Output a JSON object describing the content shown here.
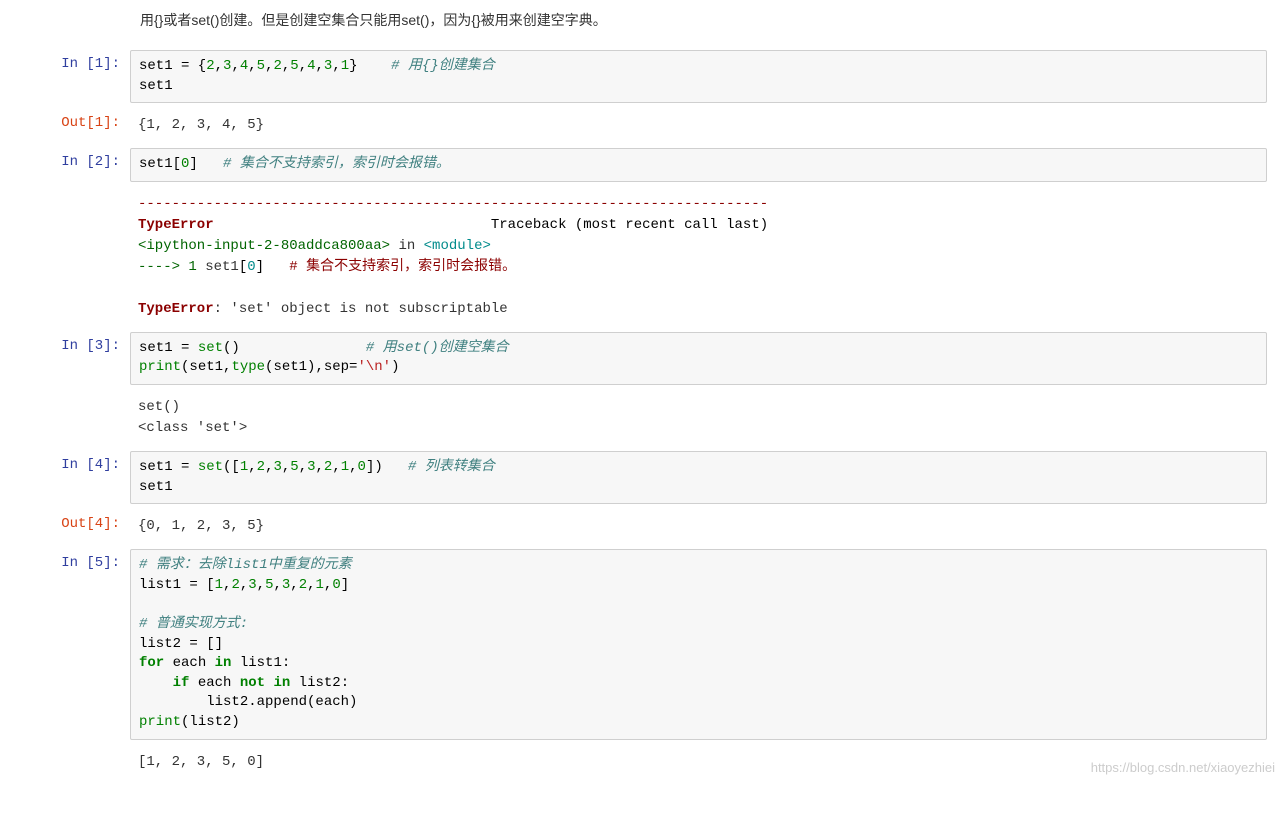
{
  "intro": "用{}或者set()创建。但是创建空集合只能用set()，因为{}被用来创建空字典。",
  "cells": {
    "in1": {
      "prompt": "In  [1]:",
      "line1_a": "set1 = {",
      "line1_b": "2",
      "line1_c": ",",
      "line1_d": "3",
      "line1_e": ",",
      "line1_f": "4",
      "line1_g": ",",
      "line1_h": "5",
      "line1_i": ",",
      "line1_j": "2",
      "line1_k": ",",
      "line1_l": "5",
      "line1_m": ",",
      "line1_n": "4",
      "line1_o": ",",
      "line1_p": "3",
      "line1_q": ",",
      "line1_r": "1",
      "line1_s": "}    ",
      "line1_comment": "# 用{}创建集合",
      "line2": "set1"
    },
    "out1": {
      "prompt": "Out[1]:",
      "text": "{1, 2, 3, 4, 5}"
    },
    "in2": {
      "prompt": "In  [2]:",
      "a": "set1[",
      "b": "0",
      "c": "]   ",
      "comment": "# 集合不支持索引，索引时会报错。"
    },
    "err2": {
      "sep": "---------------------------------------------------------------------------",
      "name": "TypeError",
      "trace": "                                 Traceback (most recent call last)",
      "file": "<ipython-input-2-80addca800aa>",
      "in_": " in ",
      "module": "<module>",
      "arrow": "----> 1",
      "code_a": " set1",
      "code_b": "[",
      "code_c": "0",
      "code_d": "]",
      "spaces": "   ",
      "comment": "# 集合不支持索引，索引时会报错。",
      "final_name": "TypeError",
      "final_msg": ": 'set' object is not subscriptable"
    },
    "in3": {
      "prompt": "In  [3]:",
      "a": "set1 = ",
      "b": "set",
      "c": "()               ",
      "comment": "# 用set()创建空集合",
      "d": "print",
      "e": "(set1,",
      "f": "type",
      "g": "(set1),sep=",
      "h": "'\\n'",
      "i": ")"
    },
    "out3": {
      "text": "set()\n<class 'set'>"
    },
    "in4": {
      "prompt": "In  [4]:",
      "a": "set1 = ",
      "b": "set",
      "c": "([",
      "n1": "1",
      "cm1": ",",
      "n2": "2",
      "cm2": ",",
      "n3": "3",
      "cm3": ",",
      "n4": "5",
      "cm4": ",",
      "n5": "3",
      "cm5": ",",
      "n6": "2",
      "cm6": ",",
      "n7": "1",
      "cm7": ",",
      "n8": "0",
      "d": "])   ",
      "comment": "# 列表转集合",
      "line2": "set1"
    },
    "out4": {
      "prompt": "Out[4]:",
      "text": "{0, 1, 2, 3, 5}"
    },
    "in5": {
      "prompt": "In  [5]:",
      "c1": "# 需求：去除list1中重复的元素",
      "l2a": "list1 = [",
      "l2n1": "1",
      "l2c1": ",",
      "l2n2": "2",
      "l2c2": ",",
      "l2n3": "3",
      "l2c3": ",",
      "l2n4": "5",
      "l2c4": ",",
      "l2n5": "3",
      "l2c5": ",",
      "l2n6": "2",
      "l2c6": ",",
      "l2n7": "1",
      "l2c7": ",",
      "l2n8": "0",
      "l2b": "]",
      "c2": "# 普通实现方式:",
      "l4": "list2 = []",
      "l5a": "for",
      "l5b": " each ",
      "l5c": "in",
      "l5d": " list1:",
      "l6a": "    ",
      "l6b": "if",
      "l6c": " each ",
      "l6d": "not",
      "l6e": " ",
      "l6f": "in",
      "l6g": " list2:",
      "l7": "        list2.append(each)",
      "l8a": "print",
      "l8b": "(list2)"
    },
    "out5": {
      "text": "[1, 2, 3, 5, 0]"
    }
  },
  "watermark": "https://blog.csdn.net/xiaoyezhiei"
}
